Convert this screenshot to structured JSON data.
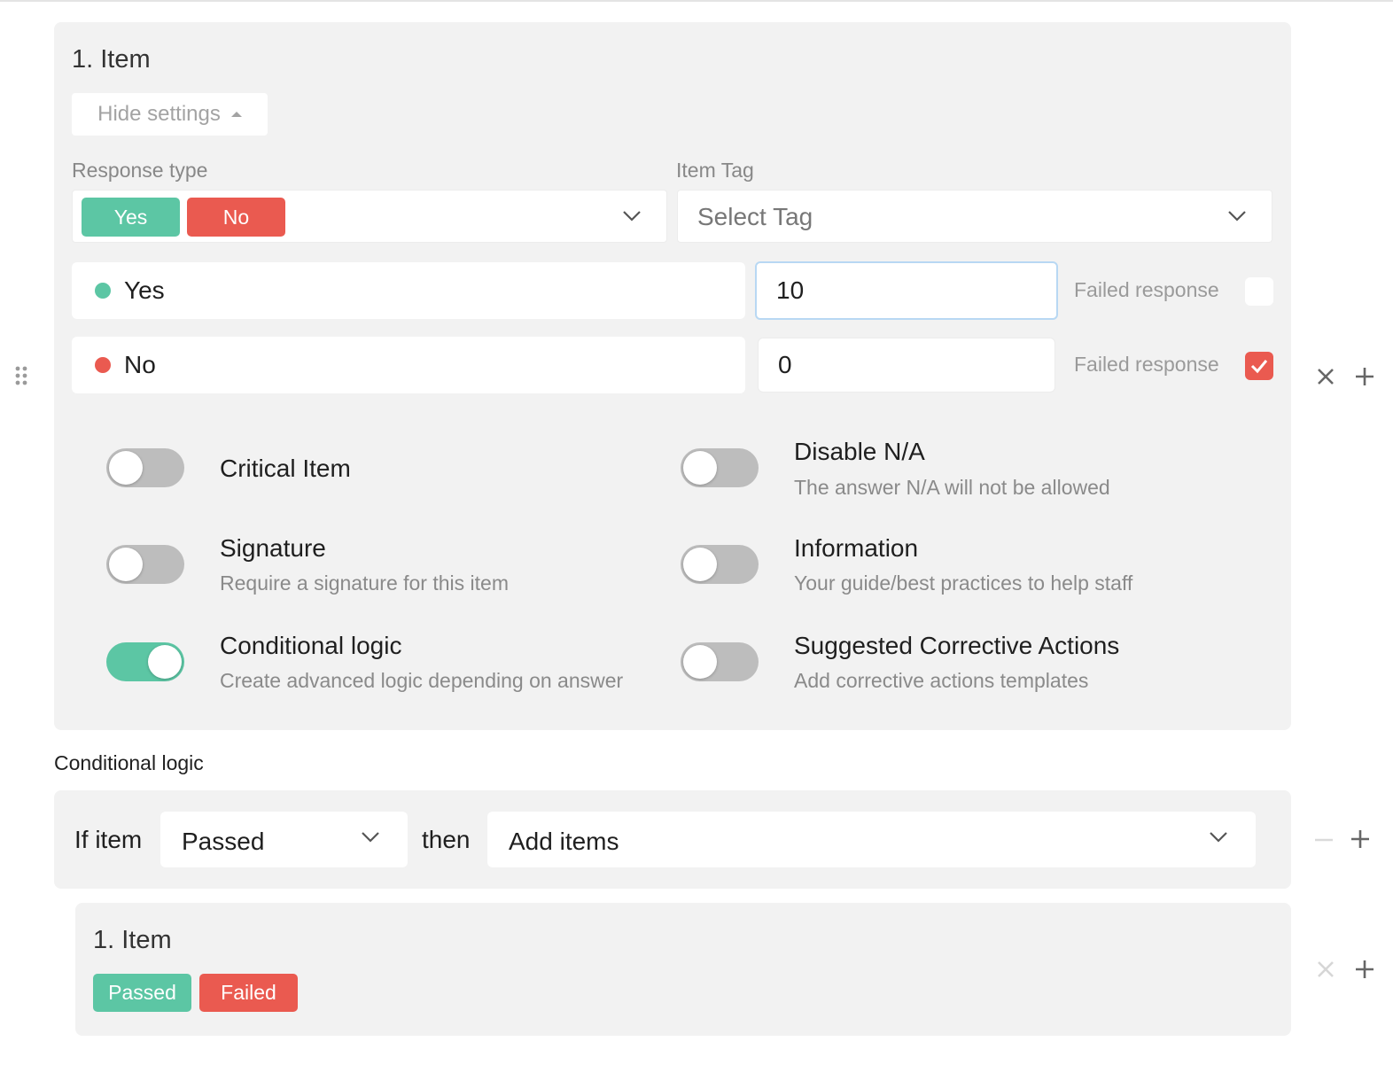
{
  "item": {
    "title": "1. Item",
    "hide_settings_label": "Hide settings",
    "response_type_label": "Response type",
    "response_type_tags": [
      "Yes",
      "No"
    ],
    "item_tag_label": "Item Tag",
    "item_tag_placeholder": "Select Tag",
    "responses": [
      {
        "label": "Yes",
        "score": "10",
        "failed_label": "Failed response",
        "failed": false,
        "color": "#5cc6a4"
      },
      {
        "label": "No",
        "score": "0",
        "failed_label": "Failed response",
        "failed": true,
        "color": "#ea5a50"
      }
    ],
    "options": {
      "critical": {
        "title": "Critical Item",
        "on": false
      },
      "disable_na": {
        "title": "Disable N/A",
        "desc": "The answer N/A will not be allowed",
        "on": false
      },
      "signature": {
        "title": "Signature",
        "desc": "Require a signature for this item",
        "on": false
      },
      "information": {
        "title": "Information",
        "desc": "Your guide/best practices to help staff",
        "on": false
      },
      "conditional": {
        "title": "Conditional logic",
        "desc": "Create advanced logic depending on answer",
        "on": true
      },
      "corrective": {
        "title": "Suggested Corrective Actions",
        "desc": "Add corrective actions templates",
        "on": false
      }
    }
  },
  "conditional": {
    "section_label": "Conditional logic",
    "if_label": "If item",
    "condition_value": "Passed",
    "then_label": "then",
    "action_value": "Add items"
  },
  "sub_item": {
    "title": "1. Item",
    "tags": [
      "Passed",
      "Failed"
    ]
  },
  "icons": [
    "drag-handle-icon",
    "close-icon",
    "plus-icon",
    "minus-icon",
    "chevron-down-icon",
    "caret-up-icon",
    "checkmark-icon"
  ],
  "colors": {
    "green": "#5cc6a4",
    "red": "#ea5a50",
    "panel": "#f2f2f2"
  }
}
